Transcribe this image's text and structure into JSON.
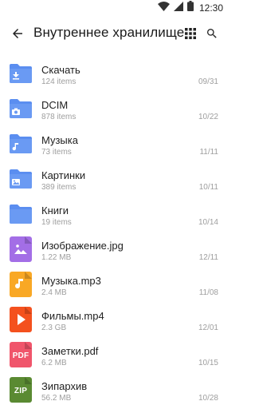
{
  "status_bar": {
    "time": "12:30"
  },
  "toolbar": {
    "title": "Внутреннее хранилище"
  },
  "colors": {
    "folder": "#5b8ef0",
    "folder_tab": "#4a7de6",
    "image_file": "#a36ee6",
    "audio_file": "#f9a825",
    "video_file": "#f4511e",
    "pdf_file": "#f0556b",
    "zip_file": "#5a8a32"
  },
  "items": [
    {
      "name": "Скачать",
      "meta": "124 items",
      "date": "09/31",
      "icon": "download-folder-icon"
    },
    {
      "name": "DCIM",
      "meta": "878 items",
      "date": "10/22",
      "icon": "camera-folder-icon"
    },
    {
      "name": "Музыка",
      "meta": "73 items",
      "date": "11/11",
      "icon": "music-folder-icon"
    },
    {
      "name": "Картинки",
      "meta": "389 items",
      "date": "10/11",
      "icon": "pictures-folder-icon"
    },
    {
      "name": "Книги",
      "meta": "19 items",
      "date": "10/14",
      "icon": "folder-icon"
    },
    {
      "name": "Изображение.jpg",
      "meta": "1.22 MB",
      "date": "12/11",
      "icon": "image-file-icon"
    },
    {
      "name": "Музыка.mp3",
      "meta": "2.4 MB",
      "date": "11/08",
      "icon": "audio-file-icon"
    },
    {
      "name": "Фильмы.mp4",
      "meta": "2.3 GB",
      "date": "12/01",
      "icon": "video-file-icon"
    },
    {
      "name": "Заметки.pdf",
      "meta": "6.2 MB",
      "date": "10/15",
      "icon": "pdf-file-icon",
      "label": "PDF"
    },
    {
      "name": "Зипархив",
      "meta": "56.2 MB",
      "date": "10/28",
      "icon": "zip-file-icon",
      "label": "ZIP"
    }
  ]
}
